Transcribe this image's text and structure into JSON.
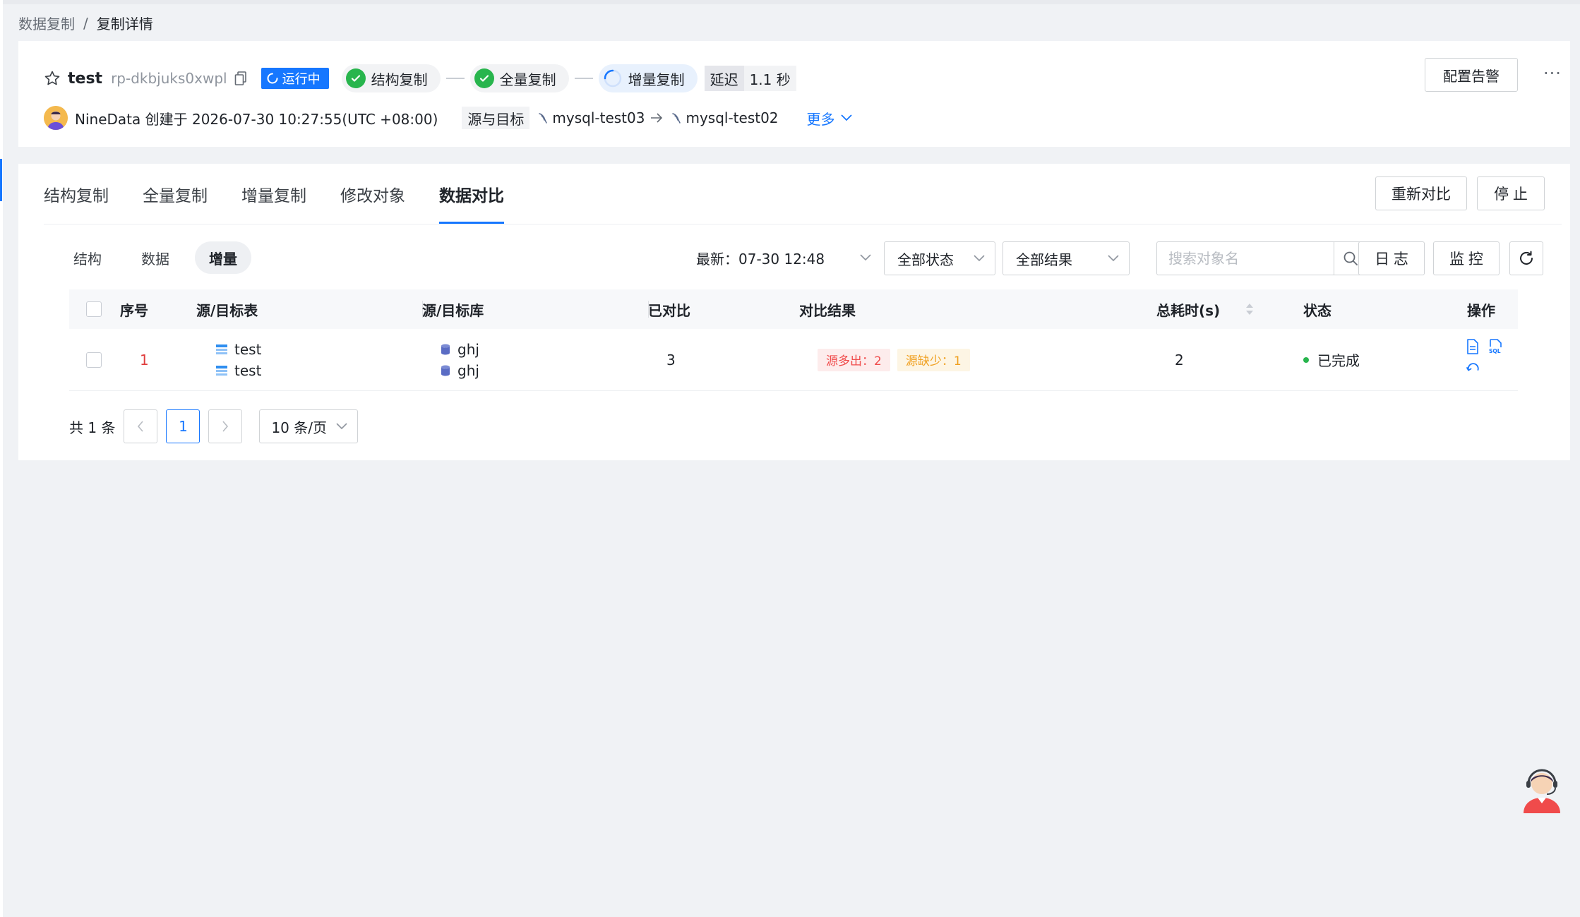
{
  "breadcrumb": {
    "parent": "数据复制",
    "separator": "/",
    "current": "复制详情"
  },
  "task": {
    "name": "test",
    "id": "rp-dkbjuks0xwpl",
    "status": "运行中",
    "steps": [
      "结构复制",
      "全量复制",
      "增量复制"
    ],
    "delay_label": "延迟",
    "delay_value": "1.1 秒",
    "creator_text": "NineData 创建于 2026-07-30 10:27:55(UTC +08:00)",
    "src_dst_label": "源与目标",
    "source": "mysql-test03",
    "target": "mysql-test02",
    "more": "更多"
  },
  "header_actions": {
    "alert": "配置告警",
    "more": "···"
  },
  "tabs": [
    "结构复制",
    "全量复制",
    "增量复制",
    "修改对象",
    "数据对比"
  ],
  "active_tab": "数据对比",
  "main_actions": {
    "recompare": "重新对比",
    "stop": "停 止"
  },
  "subtabs": [
    "结构",
    "数据",
    "增量"
  ],
  "active_subtab": "增量",
  "filters": {
    "latest": "最新：07-30 12:48",
    "status": "全部状态",
    "result": "全部结果",
    "search_placeholder": "搜索对象名",
    "log": "日 志",
    "monitor": "监 控"
  },
  "table": {
    "headers": [
      "序号",
      "源/目标表",
      "源/目标库",
      "已对比",
      "对比结果",
      "总耗时(s)",
      "状态",
      "操作"
    ],
    "rows": [
      {
        "index": "1",
        "src_table": "test",
        "dst_table": "test",
        "src_db": "ghj",
        "dst_db": "ghj",
        "compared": "3",
        "result_extra": "源多出：2",
        "result_missing": "源缺少：1",
        "duration": "2",
        "status": "已完成"
      }
    ]
  },
  "pagination": {
    "total": "共 1 条",
    "current_page": "1",
    "page_size": "10 条/页"
  },
  "colors": {
    "accent": "#1677ff",
    "success": "#28b54d",
    "danger": "#f04b4b",
    "warning": "#f0a020"
  }
}
